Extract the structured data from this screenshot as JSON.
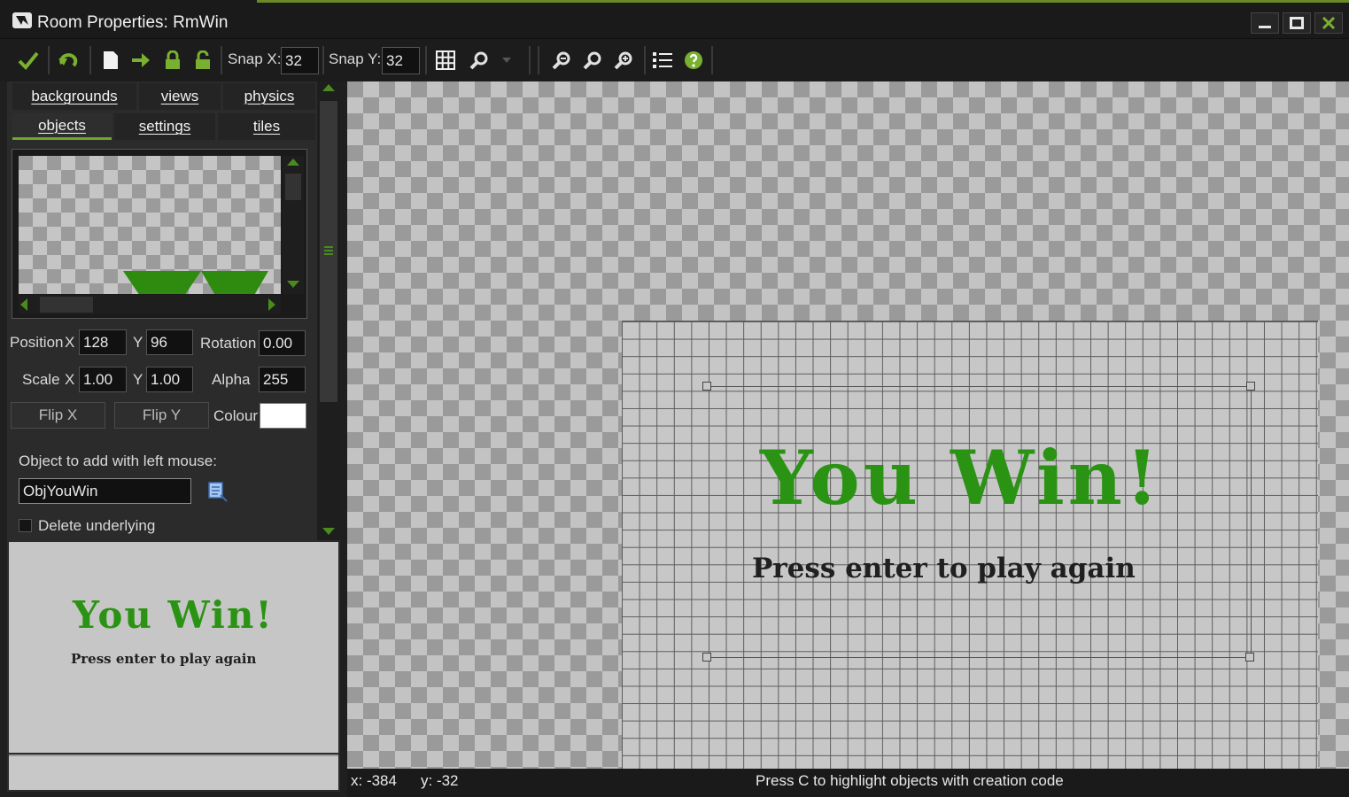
{
  "window": {
    "title": "Room Properties: RmWin"
  },
  "toolbar": {
    "snap_x_label": "Snap X:",
    "snap_x_value": "32",
    "snap_y_label": "Snap Y:",
    "snap_y_value": "32"
  },
  "tabs": {
    "row1": [
      "backgrounds",
      "views",
      "physics"
    ],
    "row2": [
      "objects",
      "settings",
      "tiles"
    ],
    "active": "objects"
  },
  "object_props": {
    "position_label": "Position",
    "x_label": "X",
    "y_label": "Y",
    "position_x": "128",
    "position_y": "96",
    "rotation_label": "Rotation",
    "rotation": "0.00",
    "scale_label": "Scale",
    "scale_x": "1.00",
    "scale_y": "1.00",
    "alpha_label": "Alpha",
    "alpha": "255",
    "flip_x_label": "Flip X",
    "flip_y_label": "Flip Y",
    "colour_label": "Colour",
    "colour_value": "#ffffff",
    "object_to_add_label": "Object to add with left mouse:",
    "object_name": "ObjYouWin",
    "delete_underlying_label": "Delete underlying",
    "delete_underlying_checked": false
  },
  "room": {
    "heading": "You Win!",
    "subheading": "Press enter to play again"
  },
  "status": {
    "x": "x: -384",
    "y": "y: -32",
    "hint": "Press C to highlight objects with creation code"
  },
  "colors": {
    "accent_green": "#2b9313",
    "toolbar_icon_green": "#7ab030"
  }
}
